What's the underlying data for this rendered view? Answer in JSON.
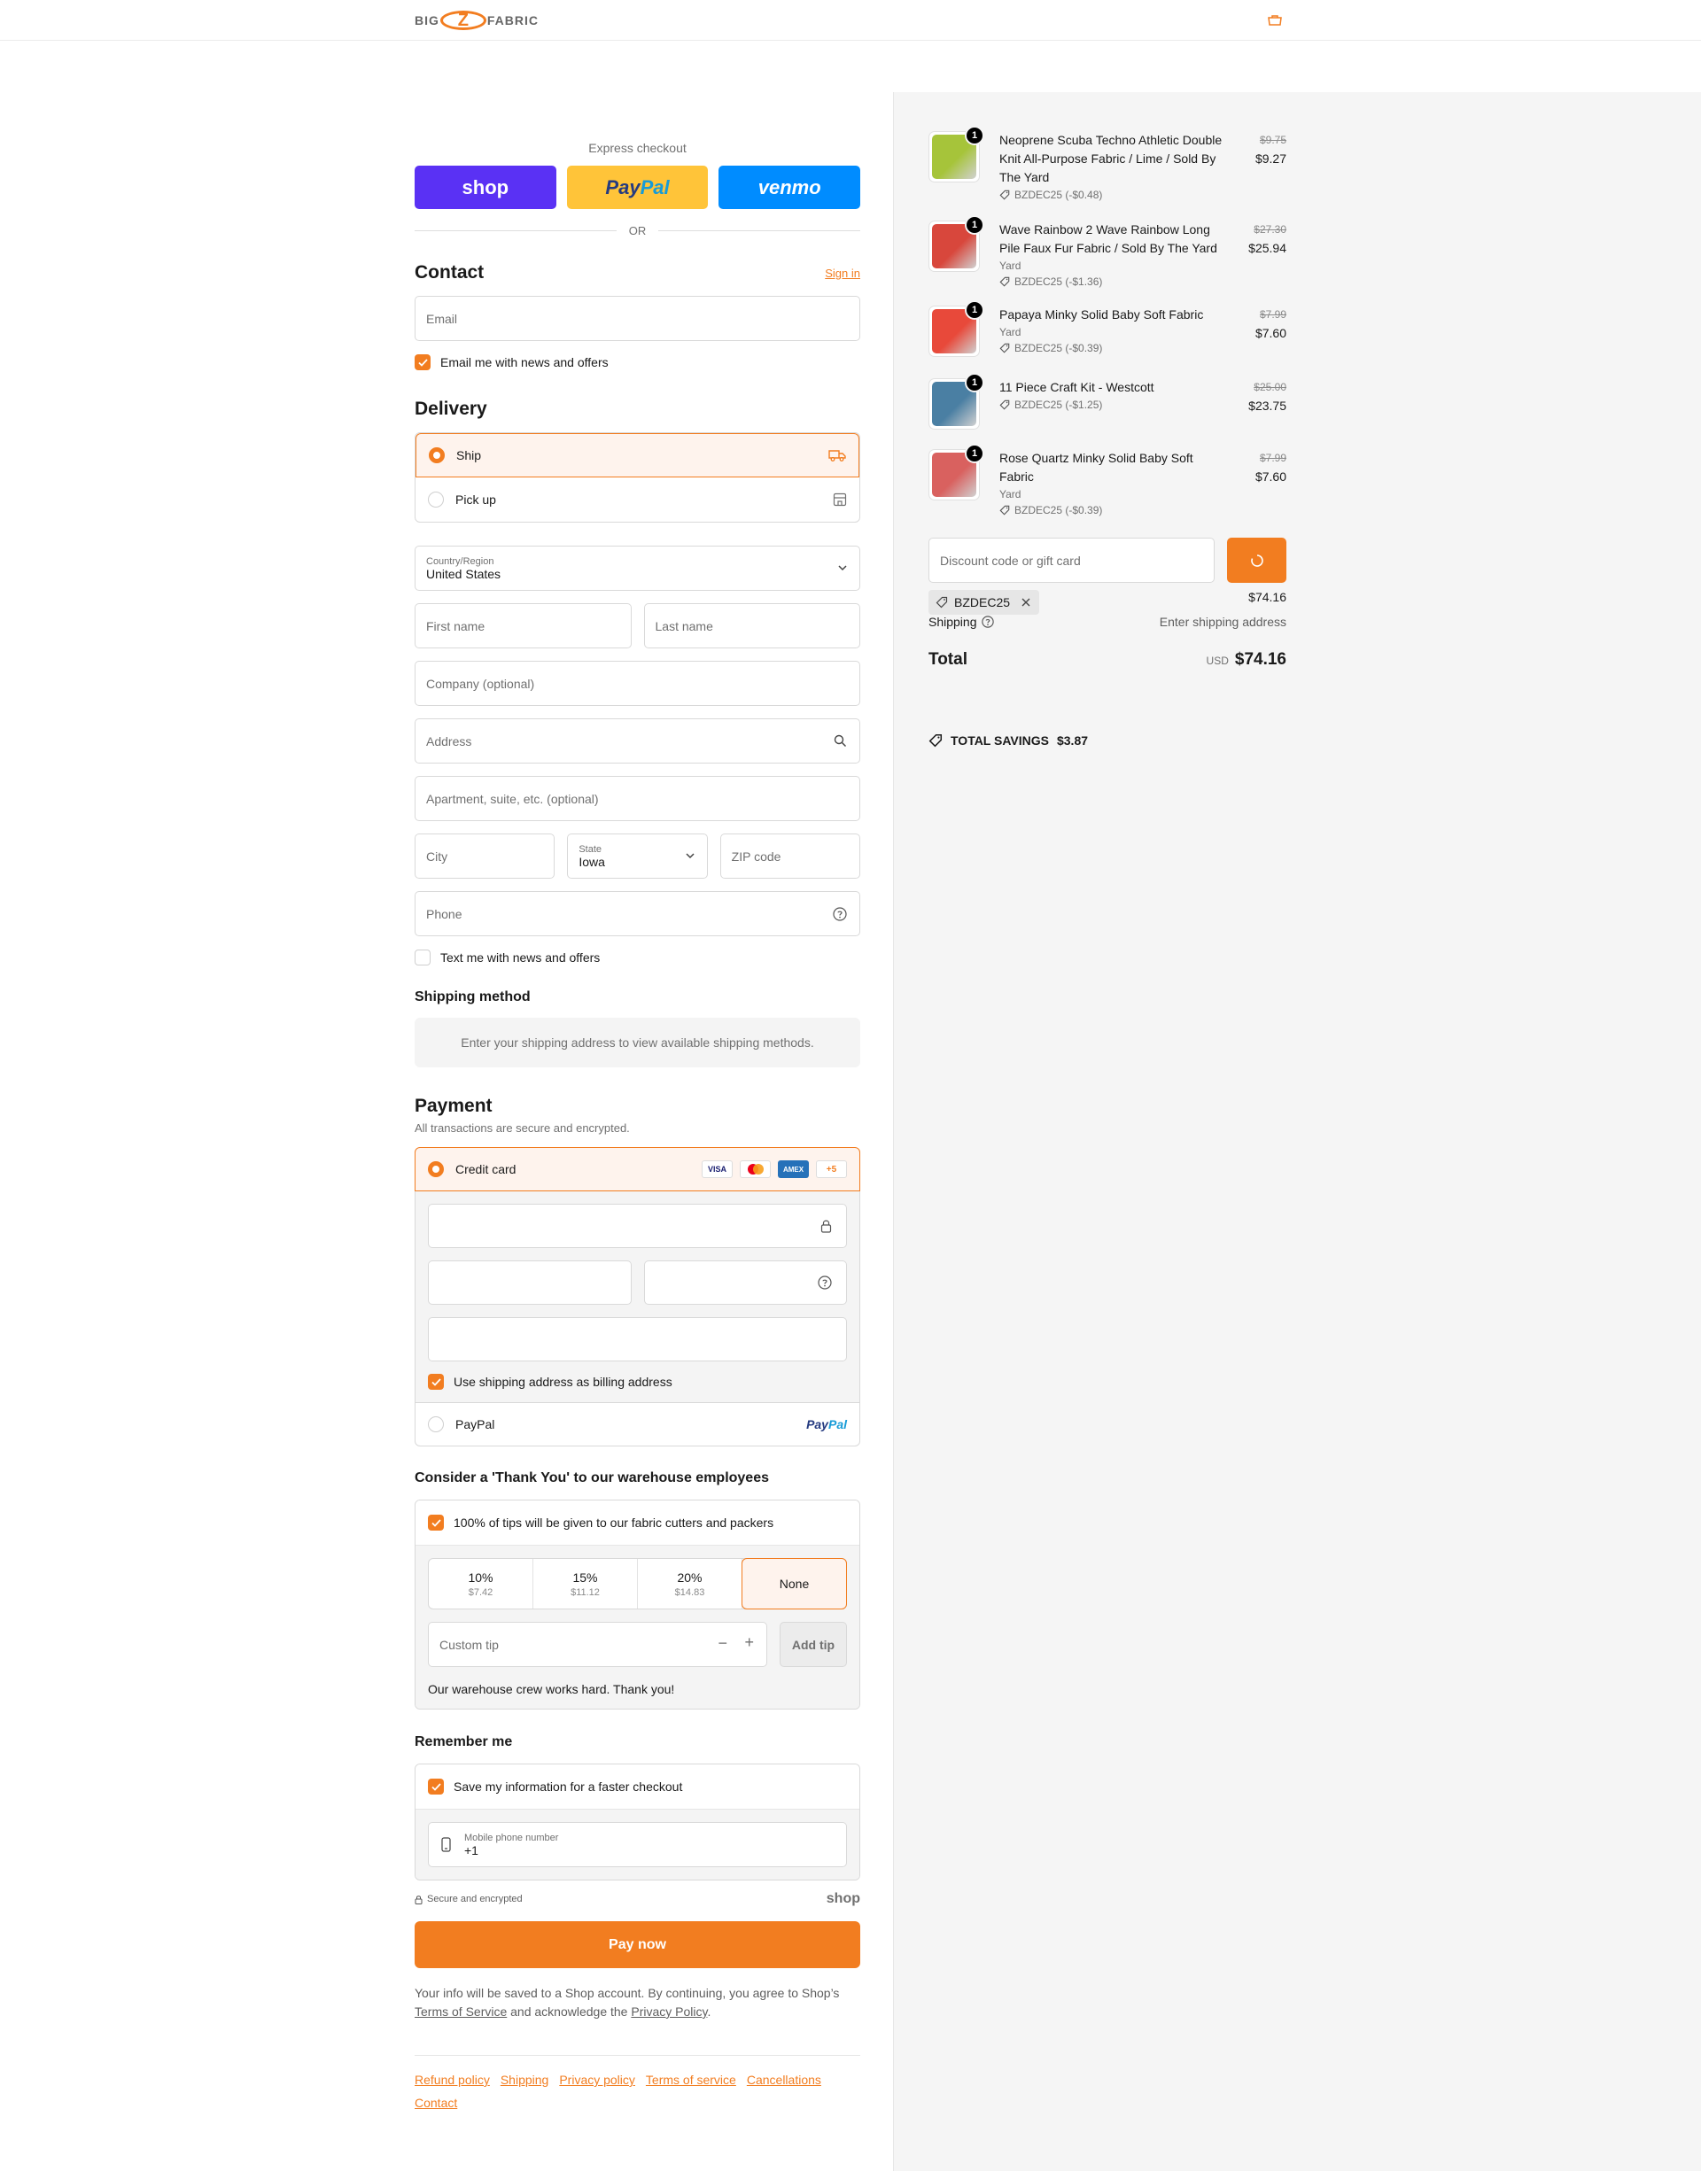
{
  "brand": {
    "left": "BIG",
    "z": "Z",
    "right": "FABRIC",
    "accent": "#f27d20"
  },
  "express": {
    "label": "Express checkout",
    "shop": "shop",
    "paypal_a": "Pay",
    "paypal_b": "Pal",
    "venmo": "venmo",
    "or": "OR"
  },
  "contact": {
    "title": "Contact",
    "sign_in": "Sign in",
    "email_placeholder": "Email",
    "news_label": "Email me with news and offers",
    "news_checked": true
  },
  "delivery": {
    "title": "Delivery",
    "options": [
      {
        "label": "Ship",
        "selected": true,
        "icon": "truck-icon"
      },
      {
        "label": "Pick up",
        "selected": false,
        "icon": "store-icon"
      }
    ],
    "country_label": "Country/Region",
    "country_value": "United States",
    "first_name": "First name",
    "last_name": "Last name",
    "company": "Company (optional)",
    "address": "Address",
    "apartment": "Apartment, suite, etc. (optional)",
    "city": "City",
    "state_label": "State",
    "state_value": "Iowa",
    "zip": "ZIP code",
    "phone": "Phone",
    "text_label": "Text me with news and offers",
    "text_checked": false
  },
  "shipping_method": {
    "title": "Shipping method",
    "message": "Enter your shipping address to view available shipping methods."
  },
  "payment": {
    "title": "Payment",
    "subtitle": "All transactions are secure and encrypted.",
    "credit_card": "Credit card",
    "card_brands": [
      "VISA",
      "mastercard",
      "AMEX"
    ],
    "more_brands": "+5",
    "billing_label": "Use shipping address as billing address",
    "paypal_label": "PayPal",
    "paypal_logo_a": "Pay",
    "paypal_logo_b": "Pal"
  },
  "tip": {
    "title": "Consider a 'Thank You' to our warehouse employees",
    "check_label": "100% of tips will be given to our fabric cutters and packers",
    "options": [
      {
        "pct": "10%",
        "amt": "$7.42"
      },
      {
        "pct": "15%",
        "amt": "$11.12"
      },
      {
        "pct": "20%",
        "amt": "$14.83"
      },
      {
        "pct": "None",
        "amt": ""
      }
    ],
    "custom_placeholder": "Custom tip",
    "add_label": "Add tip",
    "thanks": "Our warehouse crew works hard. Thank you!"
  },
  "remember": {
    "title": "Remember me",
    "check_label": "Save my information for a faster checkout",
    "phone_label": "Mobile phone number",
    "phone_value": "+1"
  },
  "secure": {
    "label": "Secure and encrypted",
    "shop": "shop"
  },
  "pay_now": "Pay now",
  "fine_print": {
    "a": "Your info will be saved to a Shop account. By continuing, you agree to Shop’s",
    "tos": "Terms of Service",
    "b": " and acknowledge the ",
    "privacy": "Privacy Policy",
    "c": "."
  },
  "footer": [
    "Refund policy",
    "Shipping",
    "Privacy policy",
    "Terms of service",
    "Cancellations",
    "Contact"
  ],
  "order": {
    "items": [
      {
        "name": "Neoprene Scuba Techno Athletic Double Knit All-Purpose Fabric / Lime / Sold By The Yard",
        "variant": "",
        "discount": "BZDEC25 (-$0.48)",
        "old": "$9.75",
        "price": "$9.27",
        "qty": "1",
        "color": "#a6c43a"
      },
      {
        "name": "Wave Rainbow 2 Wave Rainbow Long Pile Faux Fur Fabric / Sold By The Yard",
        "variant": "Yard",
        "discount": "BZDEC25 (-$1.36)",
        "old": "$27.30",
        "price": "$25.94",
        "qty": "1",
        "color": "#d8473c"
      },
      {
        "name": "Papaya Minky Solid Baby Soft Fabric",
        "variant": "Yard",
        "discount": "BZDEC25 (-$0.39)",
        "old": "$7.99",
        "price": "$7.60",
        "qty": "1",
        "color": "#e8493a"
      },
      {
        "name": "11 Piece Craft Kit - Westcott",
        "variant": "",
        "discount": "BZDEC25 (-$1.25)",
        "old": "$25.00",
        "price": "$23.75",
        "qty": "1",
        "color": "#4a7fa3"
      },
      {
        "name": "Rose Quartz Minky Solid Baby Soft Fabric",
        "variant": "Yard",
        "discount": "BZDEC25 (-$0.39)",
        "old": "$7.99",
        "price": "$7.60",
        "qty": "1",
        "color": "#d9615f"
      }
    ],
    "discount_placeholder": "Discount code or gift card",
    "code": "BZDEC25",
    "subtotal_value": "$74.16",
    "shipping_label": "Shipping",
    "shipping_value": "Enter shipping address",
    "total_label": "Total",
    "currency": "USD",
    "total_value": "$74.16",
    "savings_label": "TOTAL SAVINGS",
    "savings_value": "$3.87"
  }
}
